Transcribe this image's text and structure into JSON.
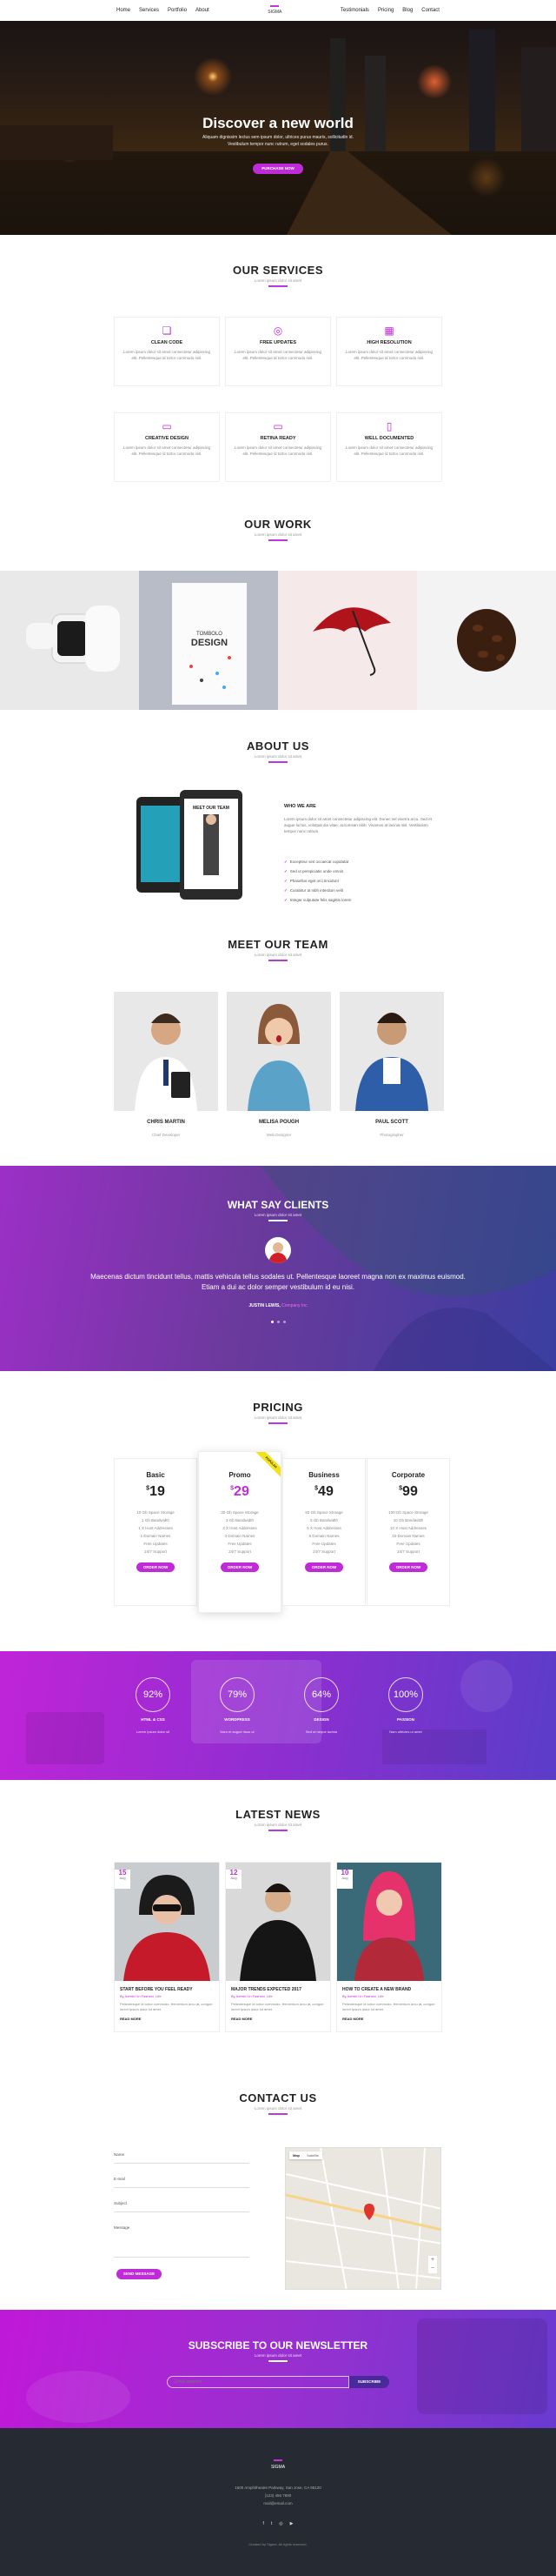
{
  "nav": {
    "left": [
      "Home",
      "Services",
      "Portfolio",
      "About"
    ],
    "right": [
      "Testimonials",
      "Pricing",
      "Blog",
      "Contact"
    ],
    "logo": "SIGMA"
  },
  "hero": {
    "title": "Discover a new world",
    "text": "Aliquam dignissim lectus sem ipsum dolor, ultrices purus mauris, sollicitudin id. Vestibulum tempor nunc rutrum, eget sodales purus.",
    "button": "PURCHASE NOW"
  },
  "services": {
    "title": "OUR SERVICES",
    "sub": "Lorem ipsum dolor sit amet",
    "items": [
      {
        "icon": "code-icon",
        "glyph": "❏",
        "name": "CLEAN CODE",
        "text": "Lorem ipsum dolor sit amet consectetur adipiscing elit. Pellentesque id tortor commodo nisl."
      },
      {
        "icon": "target-icon",
        "glyph": "◎",
        "name": "FREE UPDATES",
        "text": "Lorem ipsum dolor sit amet consectetur adipiscing elit. Pellentesque id tortor commodo nisl."
      },
      {
        "icon": "grid-icon",
        "glyph": "▦",
        "name": "HIGH RESOLUTION",
        "text": "Lorem ipsum dolor sit amet consectetur adipiscing elit. Pellentesque id tortor commodo nisl."
      },
      {
        "icon": "paint-icon",
        "glyph": "▭",
        "name": "CREATIVE DESIGN",
        "text": "Lorem ipsum dolor sit amet consectetur adipiscing elit. Pellentesque id tortor commodo nisl."
      },
      {
        "icon": "monitor-icon",
        "glyph": "▭",
        "name": "RETINA READY",
        "text": "Lorem ipsum dolor sit amet consectetur adipiscing elit. Pellentesque id tortor commodo nisl."
      },
      {
        "icon": "book-icon",
        "glyph": "▯",
        "name": "WELL DOCUMENTED",
        "text": "Lorem ipsum dolor sit amet consectetur adipiscing elit. Pellentesque id tortor commodo nisl."
      }
    ]
  },
  "work": {
    "title": "OUR WORK",
    "sub": "Lorem ipsum dolor sit amet"
  },
  "about": {
    "title": "ABOUT US",
    "sub": "Lorem ipsum dolor sit amet",
    "heading": "WHO WE ARE",
    "text": "Lorem ipsum dolor sit amet consectetur adipiscing elit. Donec vel viverra arcu. Sed et augue luctus, volutpat dui vitae, accumsan nibh. Vivamus at lacinia nisl. Vestibulum tempor nunc rutrum.",
    "points": [
      "Excepteur sint occaecat cupidatat",
      "Sed ut perspiciatis unde omnis",
      "Phasellus eget orci tincidunt",
      "Curabitur at nibh interdum velit",
      "Integer vulputate felis sagittis lorem"
    ],
    "tablet_title": "MEET OUR TEAM",
    "book_title": "DESIGN"
  },
  "team": {
    "title": "MEET OUR TEAM",
    "sub": "Lorem ipsum dolor sit amet",
    "members": [
      {
        "name": "CHRIS MARTIN",
        "role": "Chief Developer"
      },
      {
        "name": "MELISA POUGH",
        "role": "Web Designer"
      },
      {
        "name": "PAUL SCOTT",
        "role": "Photographer"
      }
    ]
  },
  "clients": {
    "title": "WHAT SAY CLIENTS",
    "sub": "Lorem ipsum dolor sit amet",
    "quote": "Maecenas dictum tincidunt tellus, mattis vehicula tellus sodales ut. Pellentesque laoreet magna non ex maximus euismod. Etiam a dui ac dolor semper vestibulum id eu nisi.",
    "author": "JUSTIN LEWIS, ",
    "company": "Company Inc"
  },
  "pricing": {
    "title": "PRICING",
    "sub": "Lorem ipsum dolor sit amet",
    "plans": [
      {
        "name": "Basic",
        "cur": "$",
        "price": "19",
        "features": [
          "10 Gb Space Storage",
          "1 Gb Bandwidth",
          "1 X Host Addresses",
          "1 Domain Names",
          "Free Updates",
          "24/7 Support"
        ],
        "button": "ORDER NOW"
      },
      {
        "name": "Promo",
        "cur": "$",
        "price": "29",
        "features": [
          "30 Gb Space Storage",
          "3 Gb Bandwidth",
          "3 X Host Addresses",
          "3 Domain Names",
          "Free Updates",
          "24/7 Support"
        ],
        "button": "ORDER NOW",
        "ribbon": "POPULAR"
      },
      {
        "name": "Business",
        "cur": "$",
        "price": "49",
        "features": [
          "50 Gb Space Storage",
          "5 Gb Bandwidth",
          "5 X Host Addresses",
          "5 Domain Names",
          "Free Updates",
          "24/7 Support"
        ],
        "button": "ORDER NOW"
      },
      {
        "name": "Corporate",
        "cur": "$",
        "price": "99",
        "features": [
          "100 Gb Space Storage",
          "10 Gb Bandwidth",
          "10 X Host Addresses",
          "10 Domain Names",
          "Free Updates",
          "24/7 Support"
        ],
        "button": "ORDER NOW"
      }
    ]
  },
  "stats": [
    {
      "value": "92%",
      "label": "HTML & CSS",
      "sub": "Lorem ipsum dolor sit"
    },
    {
      "value": "79%",
      "label": "WORDPRESS",
      "sub": "Nam et augue risus ut"
    },
    {
      "value": "64%",
      "label": "DESIGN",
      "sub": "Sed ut neque lacinia"
    },
    {
      "value": "100%",
      "label": "PASSION",
      "sub": "Nam ultricies ut amet"
    }
  ],
  "news": {
    "title": "LATEST NEWS",
    "sub": "Lorem ipsum dolor sit amet",
    "posts": [
      {
        "day": "15",
        "month": "Aug",
        "title": "START BEFORE YOU FEEL READY",
        "meta": "By Admin / In Fashion, Life",
        "text": "Pellentesque id tortor commodo, fermentum arcu at, congue lorem ipsum dolor sit amet.",
        "more": "READ MORE"
      },
      {
        "day": "12",
        "month": "Aug",
        "title": "MAJOR TRENDS EXPECTED 2017",
        "meta": "By Admin / In Fashion, Life",
        "text": "Pellentesque id tortor commodo, fermentum arcu at, congue lorem ipsum dolor sit amet.",
        "more": "READ MORE"
      },
      {
        "day": "10",
        "month": "Aug",
        "title": "HOW TO CREATE A NEW BRAND",
        "meta": "By Admin / In Fashion, Life",
        "text": "Pellentesque id tortor commodo, fermentum arcu at, congue lorem ipsum dolor sit amet.",
        "more": "READ MORE"
      }
    ]
  },
  "contact": {
    "title": "CONTACT US",
    "sub": "Lorem ipsum dolor sit amet",
    "fields": [
      "Name",
      "E-mail",
      "Subject",
      "Message"
    ],
    "button": "SEND MESSAGE",
    "map_tab": "Map",
    "map_tab2": "Satellite"
  },
  "newsletter": {
    "title": "SUBSCRIBE TO OUR NEWSLETTER",
    "sub": "Lorem ipsum dolor sit amet",
    "placeholder": "Email address",
    "button": "SUBSCRIBE"
  },
  "footer": {
    "logo": "SIGMA",
    "address": "1600 Amphitheatre Parkway, San Jose, CA 95120",
    "phone": "(123) 456 7890",
    "email": "mail@email.com",
    "copy": "Created by Sigma. All rights reserved."
  }
}
